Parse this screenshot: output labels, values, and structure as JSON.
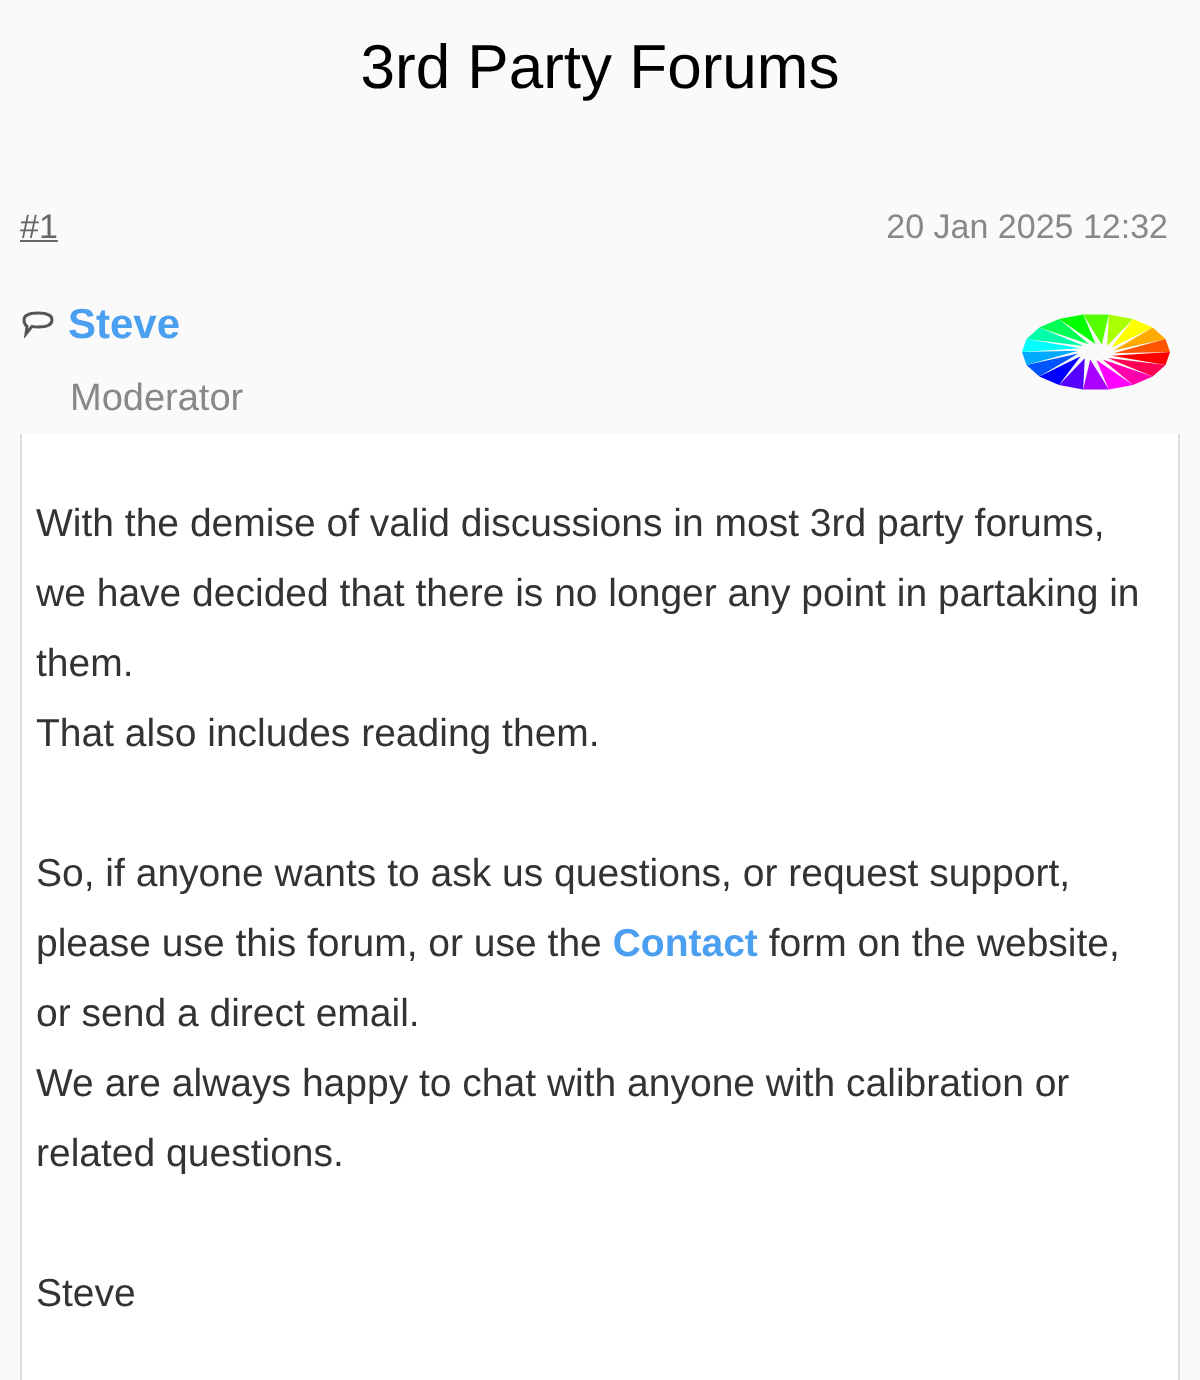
{
  "title": "3rd Party Forums",
  "post": {
    "number": "#1",
    "date": "20 Jan 2025 12:32",
    "author": "Steve",
    "role": "Moderator",
    "body": [
      {
        "kind": "text",
        "text": "With the demise of valid discussions in most 3rd party forums, we have decided that there is no longer any point in partaking in them."
      },
      {
        "kind": "text",
        "text": "That also includes reading them."
      },
      {
        "kind": "gap"
      },
      {
        "kind": "link",
        "before": "So, if anyone wants to ask us questions, or request support, please use this forum, or use the",
        "link": "Contact",
        "after": "form on the website, or send a direct email."
      },
      {
        "kind": "text",
        "text": "We are always happy to chat with anyone with calibration or related questions."
      },
      {
        "kind": "gap"
      },
      {
        "kind": "text",
        "text": "Steve"
      }
    ]
  }
}
